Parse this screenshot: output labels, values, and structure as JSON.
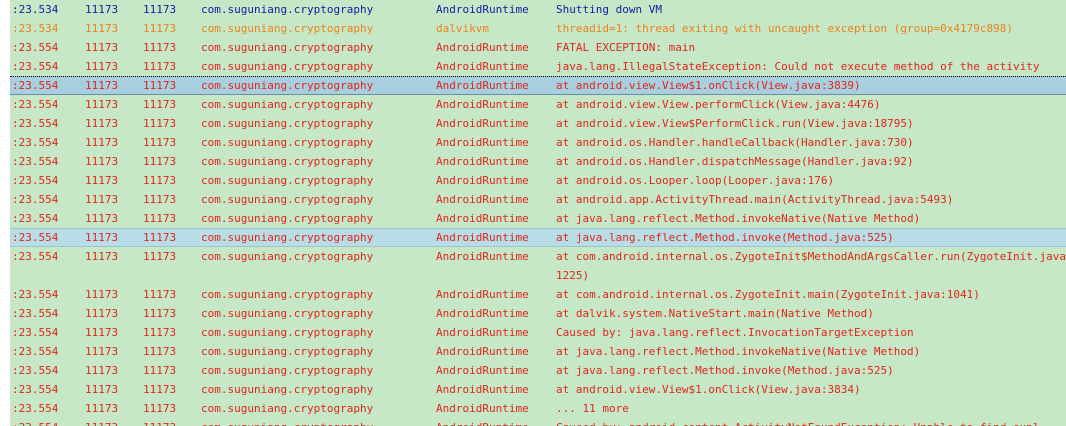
{
  "log": {
    "rows": [
      {
        "time": ":23.534",
        "pid": "11173",
        "tid": "11173",
        "app": "com.suguniang.cryptography",
        "tag": "AndroidRuntime",
        "text": "Shutting down VM"
      },
      {
        "time": ":23.534",
        "pid": "11173",
        "tid": "11173",
        "app": "com.suguniang.cryptography",
        "tag": "dalvikvm",
        "text": "threadid=1: thread exiting with uncaught exception (group=0x4179c898)"
      },
      {
        "time": ":23.554",
        "pid": "11173",
        "tid": "11173",
        "app": "com.suguniang.cryptography",
        "tag": "AndroidRuntime",
        "text": "FATAL EXCEPTION: main"
      },
      {
        "time": ":23.554",
        "pid": "11173",
        "tid": "11173",
        "app": "com.suguniang.cryptography",
        "tag": "AndroidRuntime",
        "text": "java.lang.IllegalStateException: Could not execute method of the activity"
      },
      {
        "time": ":23.554",
        "pid": "11173",
        "tid": "11173",
        "app": "com.suguniang.cryptography",
        "tag": "AndroidRuntime",
        "text": "at android.view.View$1.onClick(View.java:3839)"
      },
      {
        "time": ":23.554",
        "pid": "11173",
        "tid": "11173",
        "app": "com.suguniang.cryptography",
        "tag": "AndroidRuntime",
        "text": "at android.view.View.performClick(View.java:4476)"
      },
      {
        "time": ":23.554",
        "pid": "11173",
        "tid": "11173",
        "app": "com.suguniang.cryptography",
        "tag": "AndroidRuntime",
        "text": "at android.view.View$PerformClick.run(View.java:18795)"
      },
      {
        "time": ":23.554",
        "pid": "11173",
        "tid": "11173",
        "app": "com.suguniang.cryptography",
        "tag": "AndroidRuntime",
        "text": "at android.os.Handler.handleCallback(Handler.java:730)"
      },
      {
        "time": ":23.554",
        "pid": "11173",
        "tid": "11173",
        "app": "com.suguniang.cryptography",
        "tag": "AndroidRuntime",
        "text": "at android.os.Handler.dispatchMessage(Handler.java:92)"
      },
      {
        "time": ":23.554",
        "pid": "11173",
        "tid": "11173",
        "app": "com.suguniang.cryptography",
        "tag": "AndroidRuntime",
        "text": "at android.os.Looper.loop(Looper.java:176)"
      },
      {
        "time": ":23.554",
        "pid": "11173",
        "tid": "11173",
        "app": "com.suguniang.cryptography",
        "tag": "AndroidRuntime",
        "text": "at android.app.ActivityThread.main(ActivityThread.java:5493)"
      },
      {
        "time": ":23.554",
        "pid": "11173",
        "tid": "11173",
        "app": "com.suguniang.cryptography",
        "tag": "AndroidRuntime",
        "text": "at java.lang.reflect.Method.invokeNative(Native Method)"
      },
      {
        "time": ":23.554",
        "pid": "11173",
        "tid": "11173",
        "app": "com.suguniang.cryptography",
        "tag": "AndroidRuntime",
        "text": "at java.lang.reflect.Method.invoke(Method.java:525)"
      },
      {
        "time": ":23.554",
        "pid": "11173",
        "tid": "11173",
        "app": "com.suguniang.cryptography",
        "tag": "AndroidRuntime",
        "text": "at com.android.internal.os.ZygoteInit$MethodAndArgsCaller.run(ZygoteInit.java:1225)"
      },
      {
        "time": ":23.554",
        "pid": "11173",
        "tid": "11173",
        "app": "com.suguniang.cryptography",
        "tag": "AndroidRuntime",
        "text": "at com.android.internal.os.ZygoteInit.main(ZygoteInit.java:1041)"
      },
      {
        "time": ":23.554",
        "pid": "11173",
        "tid": "11173",
        "app": "com.suguniang.cryptography",
        "tag": "AndroidRuntime",
        "text": "at dalvik.system.NativeStart.main(Native Method)"
      },
      {
        "time": ":23.554",
        "pid": "11173",
        "tid": "11173",
        "app": "com.suguniang.cryptography",
        "tag": "AndroidRuntime",
        "text": "Caused by: java.lang.reflect.InvocationTargetException"
      },
      {
        "time": ":23.554",
        "pid": "11173",
        "tid": "11173",
        "app": "com.suguniang.cryptography",
        "tag": "AndroidRuntime",
        "text": "at java.lang.reflect.Method.invokeNative(Native Method)"
      },
      {
        "time": ":23.554",
        "pid": "11173",
        "tid": "11173",
        "app": "com.suguniang.cryptography",
        "tag": "AndroidRuntime",
        "text": "at java.lang.reflect.Method.invoke(Method.java:525)"
      },
      {
        "time": ":23.554",
        "pid": "11173",
        "tid": "11173",
        "app": "com.suguniang.cryptography",
        "tag": "AndroidRuntime",
        "text": "at android.view.View$1.onClick(View.java:3834)"
      },
      {
        "time": ":23.554",
        "pid": "11173",
        "tid": "11173",
        "app": "com.suguniang.cryptography",
        "tag": "AndroidRuntime",
        "text": "... 11 more"
      },
      {
        "time": ":23.554",
        "pid": "11173",
        "tid": "11173",
        "app": "com.suguniang.cryptography",
        "tag": "AndroidRuntime",
        "text": "Caused by: android.content.ActivityNotFoundException: Unable to find expl"
      }
    ]
  },
  "colors": {
    "background": "#c7e8c7",
    "error": "#e0261b",
    "info": "#1a1a9c",
    "warn": "#e8821e",
    "selected": "#a8cfe0",
    "highlight": "#b9dde6"
  }
}
